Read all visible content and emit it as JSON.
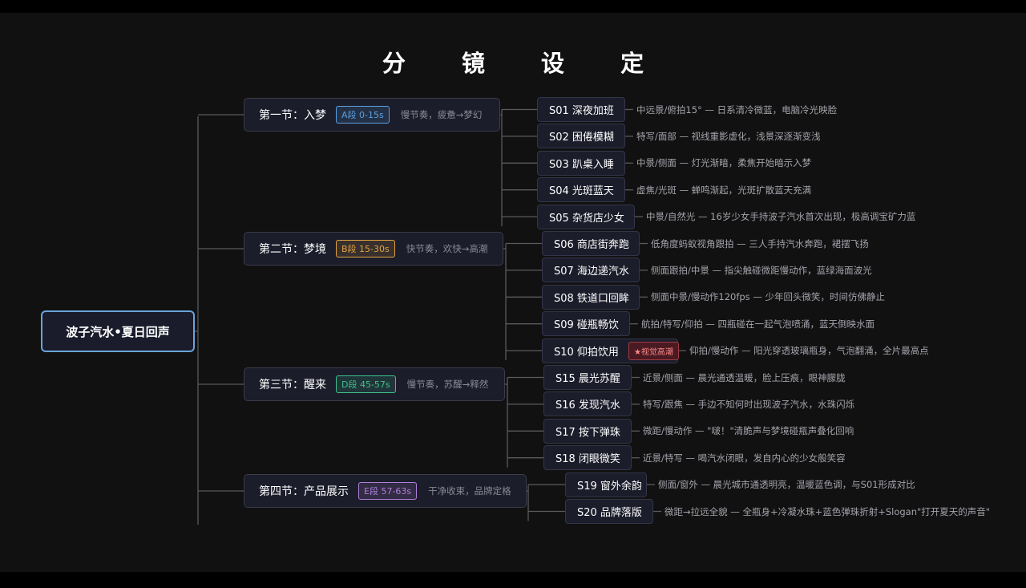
{
  "title": "分 镜 设 定",
  "root": "波子汽水•夏日回声",
  "sections": [
    {
      "title": "第一节：入梦",
      "badge": "A段 0-15s",
      "badge_color": "#5aa0e0",
      "desc": "慢节奏，疲惫→梦幻"
    },
    {
      "title": "第二节：梦境",
      "badge": "B段 15-30s",
      "badge_color": "#e0a340",
      "desc": "快节奏，欢快→高潮"
    },
    {
      "title": "第三节：醒来",
      "badge": "D段 45-57s",
      "badge_color": "#3fc28a",
      "desc": "慢节奏，苏醒→释然"
    },
    {
      "title": "第四节：产品展示",
      "badge": "E段 57-63s",
      "badge_color": "#b07fd8",
      "desc": "干净收束，品牌定格"
    }
  ],
  "shots": [
    {
      "label": "S01 深夜加班",
      "desc": "中远景/俯拍15° — 日系清冷微蓝，电脑冷光映脸"
    },
    {
      "label": "S02 困倦模糊",
      "desc": "特写/面部 — 视线重影虚化，浅景深逐渐变浅"
    },
    {
      "label": "S03 趴桌入睡",
      "desc": "中景/侧面 — 灯光渐暗，柔焦开始暗示入梦"
    },
    {
      "label": "S04 光斑蓝天",
      "desc": "虚焦/光斑 — 蝉鸣渐起，光斑扩散蓝天充满"
    },
    {
      "label": "S05 杂货店少女",
      "desc": "中景/自然光 — 16岁少女手持波子汽水首次出现，极高调宝矿力蓝"
    },
    {
      "label": "S06 商店街奔跑",
      "desc": "低角度蚂蚁视角跟拍 — 三人手持汽水奔跑，裙摆飞扬"
    },
    {
      "label": "S07 海边递汽水",
      "desc": "侧面跟拍/中景 — 指尖触碰微距慢动作，蓝绿海面波光"
    },
    {
      "label": "S08 铁道口回眸",
      "desc": "侧面中景/慢动作120fps — 少年回头微笑，时间仿佛静止"
    },
    {
      "label": "S09 碰瓶畅饮",
      "desc": "航拍/特写/仰拍 — 四瓶碰在一起气泡喷涌，蓝天倒映水面"
    },
    {
      "label": "S10 仰拍饮用",
      "highlight": "★视觉高潮",
      "desc": "仰拍/慢动作 — 阳光穿透玻璃瓶身，气泡翻涌，全片最高点"
    },
    {
      "label": "S15 晨光苏醒",
      "desc": "近景/侧面 — 晨光通透温暖，脸上压痕，眼神朦胧"
    },
    {
      "label": "S16 发现汽水",
      "desc": "特写/跟焦 — 手边不知何时出现波子汽水，水珠闪烁"
    },
    {
      "label": "S17 按下弹珠",
      "desc": "微距/慢动作 — \"啵！\"清脆声与梦境碰瓶声叠化回响"
    },
    {
      "label": "S18 闭眼微笑",
      "desc": "近景/特写 — 喝汽水闭眼，发自内心的少女般笑容"
    },
    {
      "label": "S19 窗外余韵",
      "desc": "侧面/窗外 — 晨光城市通透明亮，温暖蓝色调，与S01形成对比"
    },
    {
      "label": "S20 品牌落版",
      "desc": "微距→拉远全貌 — 全瓶身+冷凝水珠+蓝色弹珠折射+Slogan\"打开夏天的声音\""
    }
  ]
}
